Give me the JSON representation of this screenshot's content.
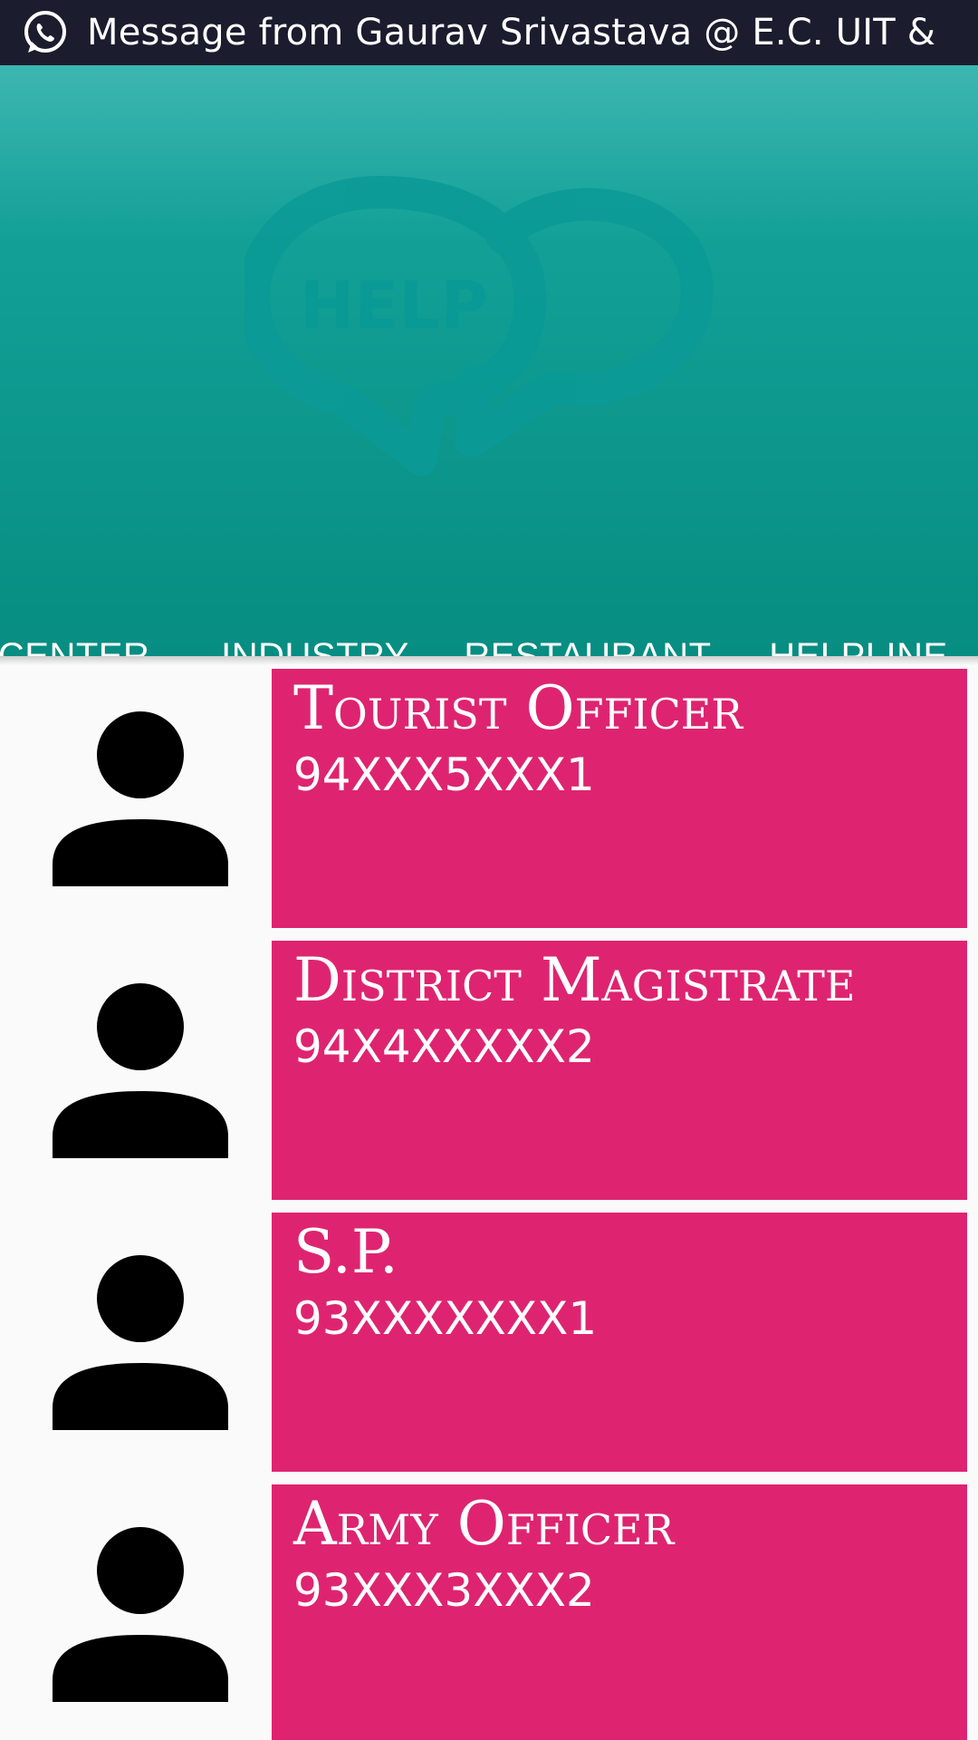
{
  "notification": {
    "text": "Message from Gaurav Srivastava @ E.C. UIT &",
    "icon": "whatsapp-icon"
  },
  "header": {
    "graphic_text": "HELP",
    "graphic_icon": "help-chat-bubbles-icon"
  },
  "tabs": [
    {
      "label": "G CENTER"
    },
    {
      "label": "INDUSTRY"
    },
    {
      "label": "RESTAURANT"
    },
    {
      "label": "HELPLINE",
      "selected": true
    }
  ],
  "contacts": [
    {
      "name": "Tourist Officer",
      "phone": "94XXX5XXX1"
    },
    {
      "name": "District Magistrate",
      "phone": "94X4XXXXX2"
    },
    {
      "name": "S.P.",
      "phone": "93XXXXXXX1"
    },
    {
      "name": "Army Officer",
      "phone": "93XXX3XXX2"
    }
  ],
  "colors": {
    "status_bar": "#1b1c2e",
    "header_teal": "#078d82",
    "card_pink": "#de2470",
    "tab_indicator": "#ffffff"
  }
}
